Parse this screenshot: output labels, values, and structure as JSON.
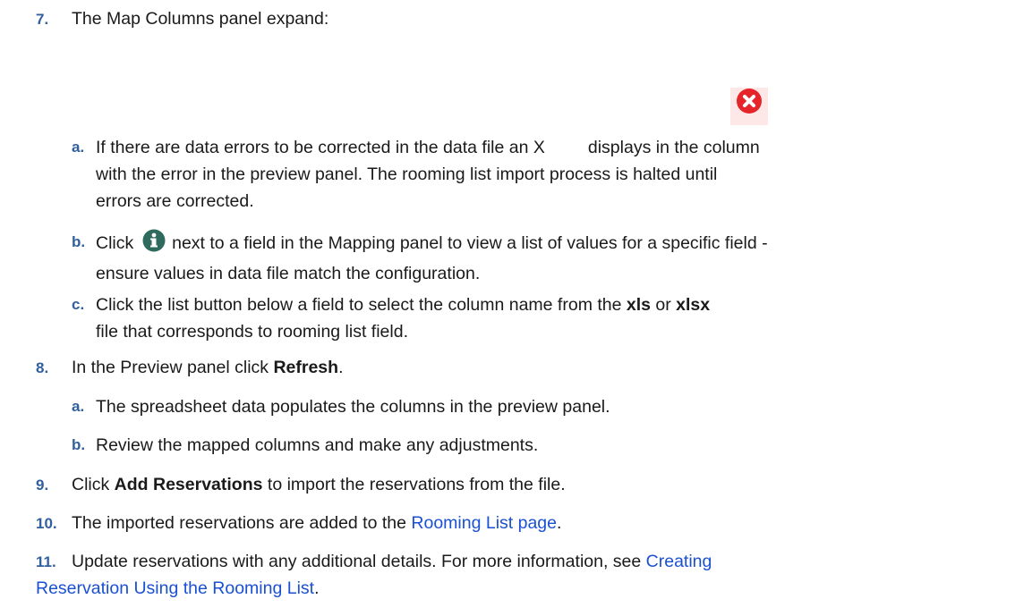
{
  "steps": [
    {
      "num": "7.",
      "text": "The Map Columns panel expand:"
    },
    {
      "num": "8.",
      "pre": "In the Preview panel click ",
      "bold": "Refresh",
      "post": "."
    },
    {
      "num": "9.",
      "pre": "Click ",
      "bold": "Add Reservations",
      "post": " to import the reservations from the file."
    },
    {
      "num": "10.",
      "pre": "The imported reservations are added to the ",
      "link": "Rooming List page",
      "post": "."
    },
    {
      "num": "11.",
      "pre": "Update reservations with any additional details. For more information, see ",
      "link": "Creating",
      "link2": "Reservation Using the Rooming List",
      "post": "."
    }
  ],
  "sub7": [
    {
      "letter": "a.",
      "l1_pre": "If there are data errors to be corrected in the data file an X",
      "l1_post": "displays in the column",
      "l2": "with the error in the preview panel. The rooming list import process is halted until",
      "l3": "errors are corrected."
    },
    {
      "letter": "b.",
      "l1_pre": "Click",
      "l1_post": "next to a field in the Mapping panel to view a list of values for a specific field -",
      "l2": "ensure values in data file match the configuration."
    },
    {
      "letter": "c.",
      "l1_pre": "Click the list button below a field to select the column name from the ",
      "b1": "xls",
      "mid": " or ",
      "b2": "xlsx",
      "l2": " file that corresponds to rooming list field."
    }
  ],
  "sub8": [
    {
      "letter": "a.",
      "text": "The spreadsheet data populates the columns in the preview panel."
    },
    {
      "letter": "b.",
      "text": "Review the mapped columns and make any adjustments."
    }
  ],
  "icons": {
    "error": "error-x-icon",
    "info": "info-icon"
  },
  "colors": {
    "number": "#31609e",
    "link": "#1a50d2",
    "error": "#e5252a",
    "info_icon": "#2f6a5e"
  }
}
